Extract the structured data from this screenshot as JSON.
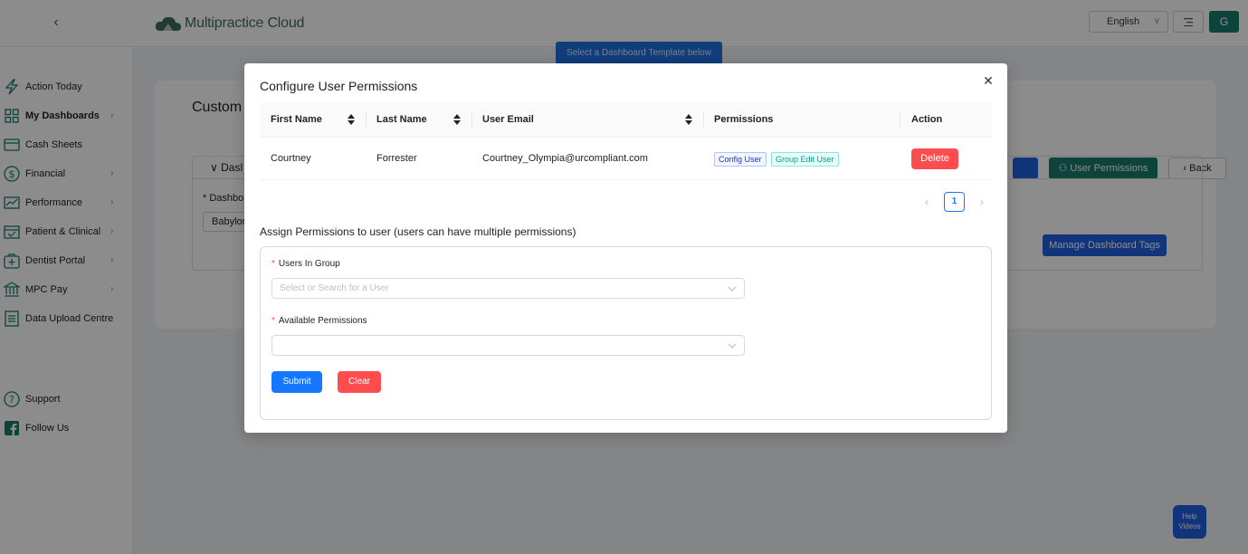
{
  "header": {
    "brand_name": "Multipractice Cloud",
    "language": "English",
    "user_initial": "G"
  },
  "sidebar": {
    "items": [
      {
        "label": "Action Today",
        "icon": "lightning-icon",
        "chevron": false,
        "bold": false
      },
      {
        "label": "My Dashboards",
        "icon": "grid-icon",
        "chevron": true,
        "bold": true
      },
      {
        "label": "Cash Sheets",
        "icon": "card-icon",
        "chevron": false,
        "bold": false
      },
      {
        "label": "Financial",
        "icon": "dollar-icon",
        "chevron": true,
        "bold": false
      },
      {
        "label": "Performance",
        "icon": "trend-icon",
        "chevron": true,
        "bold": false
      },
      {
        "label": "Patient & Clinical",
        "icon": "calendar-icon",
        "chevron": true,
        "bold": false
      },
      {
        "label": "Dentist Portal",
        "icon": "medical-bag-icon",
        "chevron": true,
        "bold": false
      },
      {
        "label": "MPC Pay",
        "icon": "bank-icon",
        "chevron": true,
        "bold": false
      },
      {
        "label": "Data Upload Centre",
        "icon": "upload-doc-icon",
        "chevron": false,
        "bold": false
      }
    ],
    "support_label": "Support",
    "follow_label": "Follow Us"
  },
  "background": {
    "card_title": "Custom",
    "section_title": "Dasl",
    "dashboard_label": "* Dashbo",
    "dashboard_value": "Babylon",
    "user_permissions_button": "User Permissions",
    "back_button": "Back",
    "manage_tags_button": "Manage Dashboard Tags",
    "template_tooltip": "Select a Dashboard Template below",
    "help_videos": "Help Videos"
  },
  "modal": {
    "title": "Configure User Permissions",
    "columns": [
      "First Name",
      "Last Name",
      "User Email",
      "Permissions",
      "Action"
    ],
    "rows": [
      {
        "first_name": "Courtney",
        "last_name": "Forrester",
        "email": "Courtney_Olympia@urcompliant.com",
        "permissions": [
          "Config User",
          "Group Edit User"
        ],
        "action": "Delete"
      }
    ],
    "pagination": {
      "current_page": "1"
    },
    "assign_title": "Assign Permissions to user (users can have multiple permissions)",
    "form": {
      "users_label": "Users In Group",
      "users_placeholder": "Select or Search for a User",
      "permissions_label": "Available Permissions",
      "permissions_value": "",
      "submit_label": "Submit",
      "clear_label": "Clear"
    }
  },
  "colors": {
    "brand_teal": "#1a7a6c",
    "primary_blue": "#1677ff",
    "danger_red": "#ff4d4f"
  }
}
